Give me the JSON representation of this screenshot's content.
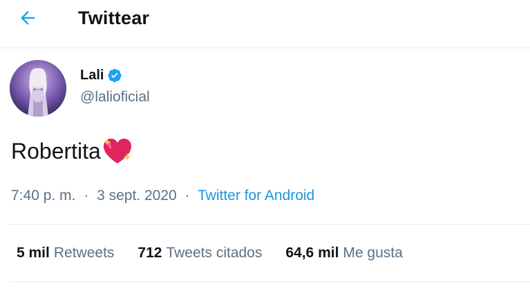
{
  "header": {
    "title": "Twittear",
    "back_icon": "arrow-left-icon",
    "accent_color": "#1da1f2"
  },
  "author": {
    "display_name": "Lali",
    "verified_icon": "verified-badge-icon",
    "handle": "@lalioficial"
  },
  "tweet": {
    "text": "Robertita",
    "emoji": "sparkling-heart-emoji"
  },
  "meta": {
    "time": "7:40 p. m.",
    "separator": "·",
    "date": "3 sept. 2020",
    "source": "Twitter for Android"
  },
  "stats": {
    "retweets_count": "5 mil",
    "retweets_label": "Retweets",
    "quotes_count": "712",
    "quotes_label": "Tweets citados",
    "likes_count": "64,6 mil",
    "likes_label": "Me gusta"
  },
  "colors": {
    "text_primary": "#0f1419",
    "text_secondary": "#5b7083",
    "link": "#1b95e0",
    "divider": "#e6ecf0"
  }
}
